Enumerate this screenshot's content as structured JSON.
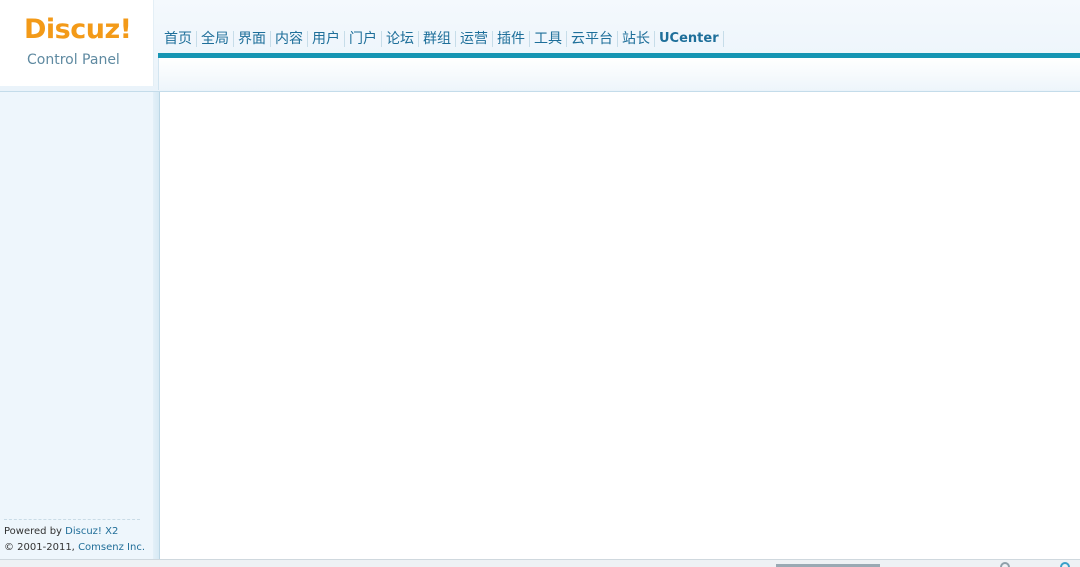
{
  "header": {
    "logo": "Discuz!",
    "logo_subtitle": "Control Panel"
  },
  "nav": {
    "items": [
      {
        "label": "首页"
      },
      {
        "label": "全局"
      },
      {
        "label": "界面"
      },
      {
        "label": "内容"
      },
      {
        "label": "用户"
      },
      {
        "label": "门户"
      },
      {
        "label": "论坛"
      },
      {
        "label": "群组"
      },
      {
        "label": "运营"
      },
      {
        "label": "插件"
      },
      {
        "label": "工具"
      },
      {
        "label": "云平台"
      },
      {
        "label": "站长"
      },
      {
        "label": "UCenter"
      }
    ]
  },
  "sidebar": {
    "powered_prefix": "Powered by",
    "powered_product": "Discuz! X2",
    "copyright_prefix": "© 2001-2011,",
    "company": "Comsenz Inc."
  },
  "colors": {
    "logo": "#f39a18",
    "nav_text": "#1e6f9a",
    "nav_bar": "#1595b3",
    "sidebar_bg": "#eef6fc"
  }
}
